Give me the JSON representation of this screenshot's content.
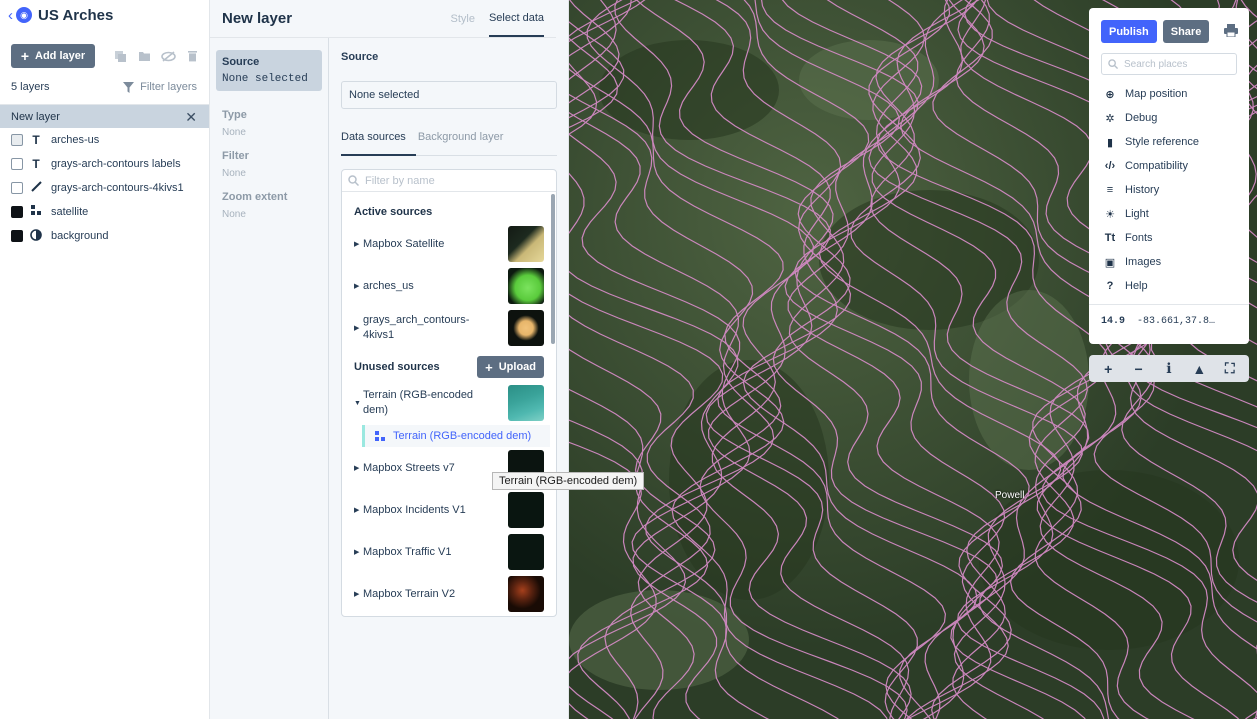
{
  "app": {
    "title": "US Arches",
    "back_icon": "chevron-left-icon",
    "logo_icon": "studio-logo-icon"
  },
  "sidebar": {
    "add_layer_label": "Add layer",
    "layer_count": "5 layers",
    "filter_label": "Filter layers",
    "new_layer": "New layer",
    "layers": [
      {
        "name": "arches-us",
        "type_icon": "text-icon",
        "visible": false
      },
      {
        "name": "grays-arch-contours labels",
        "type_icon": "text-icon",
        "visible": false
      },
      {
        "name": "grays-arch-contours-4kivs1",
        "type_icon": "line-icon",
        "visible": false
      },
      {
        "name": "satellite",
        "type_icon": "raster-icon",
        "visible": true
      },
      {
        "name": "background",
        "type_icon": "background-icon",
        "visible": true
      }
    ]
  },
  "panel": {
    "title": "New layer",
    "tabs": [
      "Style",
      "Select data"
    ],
    "props": [
      {
        "label": "Source",
        "value": "None selected"
      },
      {
        "label": "Type",
        "value": "None"
      },
      {
        "label": "Filter",
        "value": "None"
      },
      {
        "label": "Zoom extent",
        "value": "None"
      }
    ],
    "source_label": "Source",
    "source_value": "None selected",
    "subtabs": [
      "Data sources",
      "Background layer"
    ],
    "filter_placeholder": "Filter by name",
    "active_title": "Active sources",
    "active_sources": [
      {
        "name": "Mapbox Satellite"
      },
      {
        "name": "arches_us"
      },
      {
        "name": "grays_arch_contours-4kivs1"
      }
    ],
    "unused_title": "Unused sources",
    "upload_label": "Upload",
    "unused_sources": [
      {
        "name": "Terrain (RGB-encoded dem)",
        "expanded": true,
        "child": "Terrain (RGB-encoded dem)"
      },
      {
        "name": "Mapbox Streets v7"
      },
      {
        "name": "Mapbox Incidents V1"
      },
      {
        "name": "Mapbox Traffic V1"
      },
      {
        "name": "Mapbox Terrain V2"
      }
    ],
    "tooltip": "Terrain (RGB-encoded dem)"
  },
  "map": {
    "place_label": "Powell",
    "publish_label": "Publish",
    "share_label": "Share",
    "search_placeholder": "Search places",
    "menu": [
      "Map position",
      "Debug",
      "Style reference",
      "Compatibility",
      "History",
      "Light",
      "Fonts",
      "Images",
      "Help"
    ],
    "zoom": "14.9",
    "coords": "-83.661,37.8…",
    "contour_color": "#d38ac4",
    "accent": "#4264fb"
  }
}
